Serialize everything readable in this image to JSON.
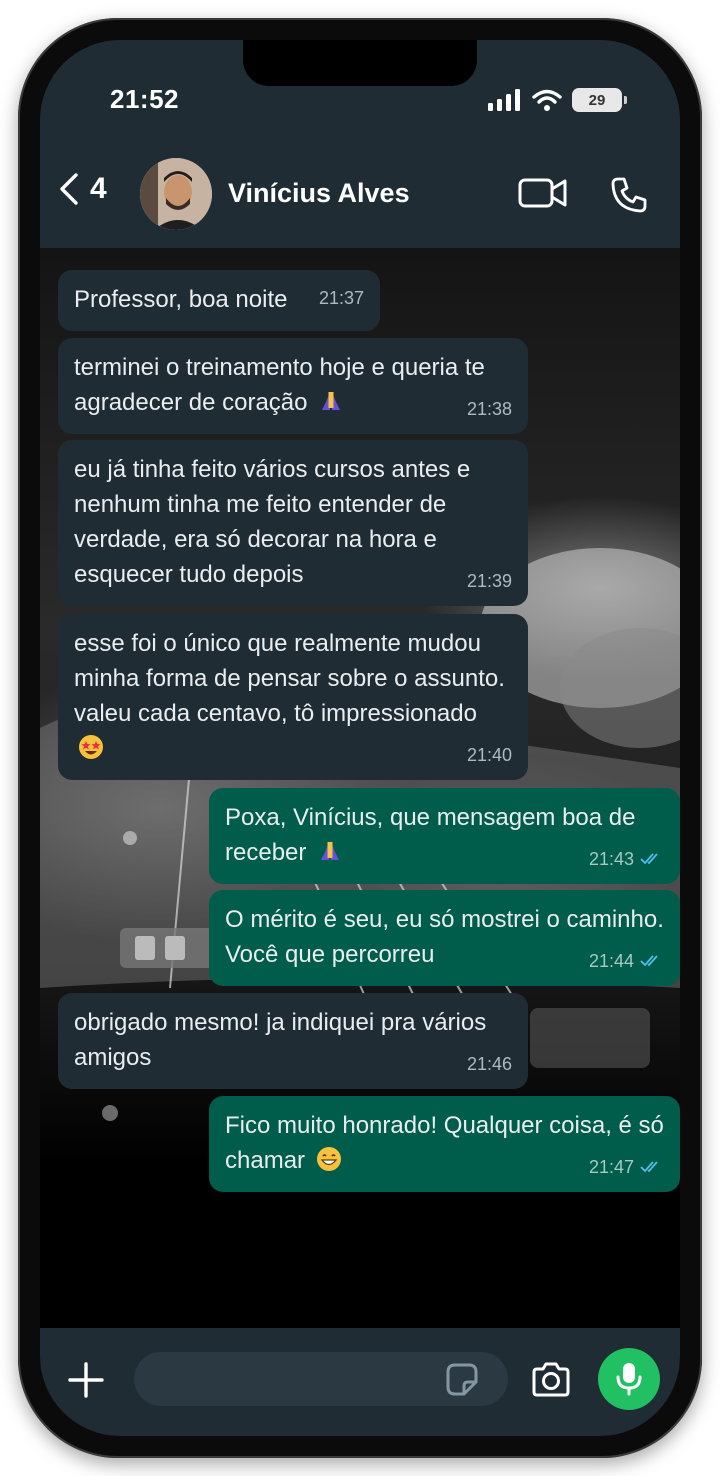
{
  "status": {
    "time": "21:52",
    "battery": "29"
  },
  "header": {
    "back_count": "4",
    "contact_name": "Vinícius Alves"
  },
  "messages": [
    {
      "direction": "in",
      "text": "Professor, boa noite",
      "time": "21:37"
    },
    {
      "direction": "in",
      "text": "terminei o treinamento hoje e queria te agradecer de coração",
      "emoji": "folded-hands",
      "time": "21:38"
    },
    {
      "direction": "in",
      "text": "eu já tinha feito vários cursos antes e nenhum tinha me feito entender de verdade, era só decorar na hora e esquecer tudo depois",
      "time": "21:39"
    },
    {
      "direction": "in",
      "text": "esse foi o único que realmente mudou minha forma de pensar sobre o assunto. valeu cada centavo, tô impressionado",
      "emoji": "star-struck",
      "time": "21:40"
    },
    {
      "direction": "out",
      "text": "Poxa, Vinícius, que mensagem boa de receber",
      "emoji": "folded-hands",
      "time": "21:43",
      "read": true
    },
    {
      "direction": "out",
      "text": "O mérito é seu, eu só mostrei o caminho. Você que percorreu",
      "time": "21:44",
      "read": true
    },
    {
      "direction": "in",
      "text": "obrigado mesmo! ja indiquei pra vários amigos",
      "time": "21:46"
    },
    {
      "direction": "out",
      "text": "Fico muito honrado! Qualquer coisa, é só chamar",
      "emoji": "grinning-face",
      "time": "21:47",
      "read": true
    }
  ],
  "colors": {
    "incoming_bubble": "#202c33",
    "outgoing_bubble": "#005c4b",
    "header_bg": "#1f2c33",
    "mic_button": "#21c063",
    "read_ticks": "#53bdeb"
  },
  "icons": {
    "back": "chevron-left-icon",
    "video_call": "video-camera-icon",
    "voice_call": "phone-icon",
    "attach": "plus-icon",
    "sticker": "sticker-icon",
    "camera": "camera-icon",
    "mic": "microphone-icon"
  }
}
